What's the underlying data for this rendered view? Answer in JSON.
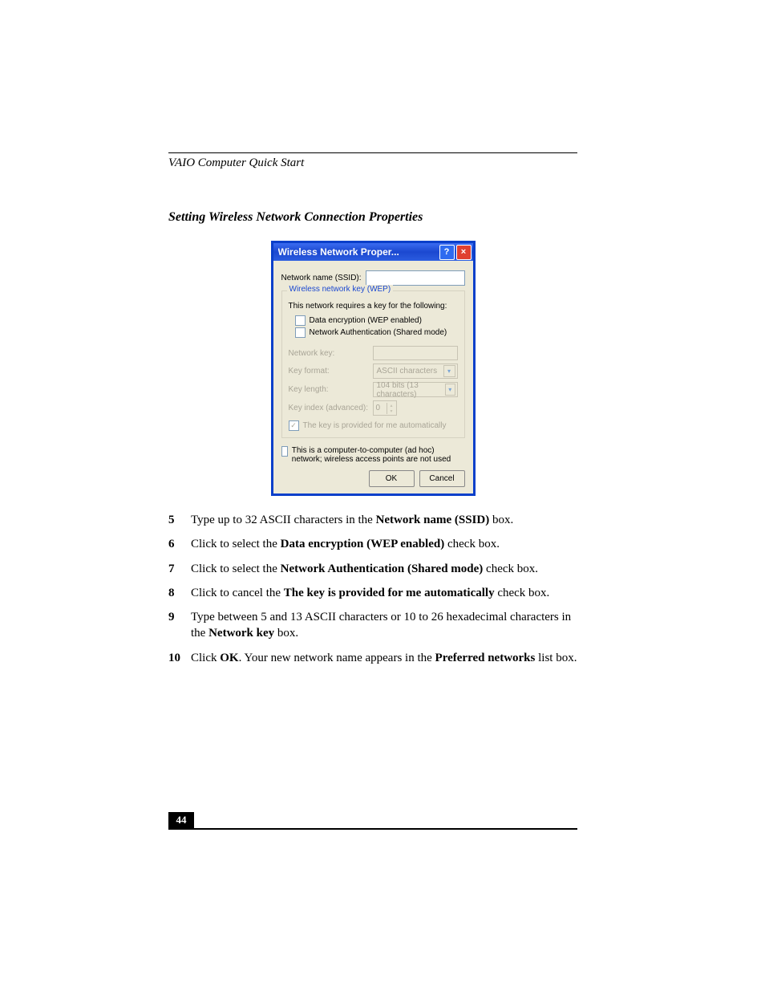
{
  "header": {
    "running": "VAIO Computer Quick Start"
  },
  "section": {
    "title": "Setting Wireless Network Connection Properties"
  },
  "dialog": {
    "title": "Wireless Network Proper...",
    "ssid_label": "Network name (SSID):",
    "group_legend": "Wireless network key (WEP)",
    "note": "This network requires a key for the following:",
    "cb_encryption": "Data encryption (WEP enabled)",
    "cb_auth": "Network Authentication (Shared mode)",
    "key_label": "Network key:",
    "format_label": "Key format:",
    "format_value": "ASCII characters",
    "length_label": "Key length:",
    "length_value": "104 bits (13 characters)",
    "index_label": "Key index (advanced):",
    "index_value": "0",
    "autokey": "The key is provided for me automatically",
    "adhoc": "This is a computer-to-computer (ad hoc) network; wireless access points are not used",
    "ok": "OK",
    "cancel": "Cancel"
  },
  "steps": [
    {
      "n": "5",
      "pre": "Type up to 32 ASCII characters in the ",
      "bold": "Network name (SSID)",
      "post": " box."
    },
    {
      "n": "6",
      "pre": "Click to select the ",
      "bold": "Data encryption (WEP enabled)",
      "post": " check box."
    },
    {
      "n": "7",
      "pre": "Click to select the ",
      "bold": "Network Authentication (Shared mode)",
      "post": " check box."
    },
    {
      "n": "8",
      "pre": "Click to cancel the ",
      "bold": "The key is provided for me automatically",
      "post": " check box."
    },
    {
      "n": "9",
      "pre": "Type between 5 and 13 ASCII characters or 10 to 26 hexadecimal characters in the ",
      "bold": "Network key",
      "post": " box."
    }
  ],
  "step10": {
    "n": "10",
    "p1": "Click ",
    "b1": "OK",
    "p2": ". Your new network name appears in the ",
    "b2": "Preferred networks",
    "p3": " list box."
  },
  "footer": {
    "page": "44"
  }
}
